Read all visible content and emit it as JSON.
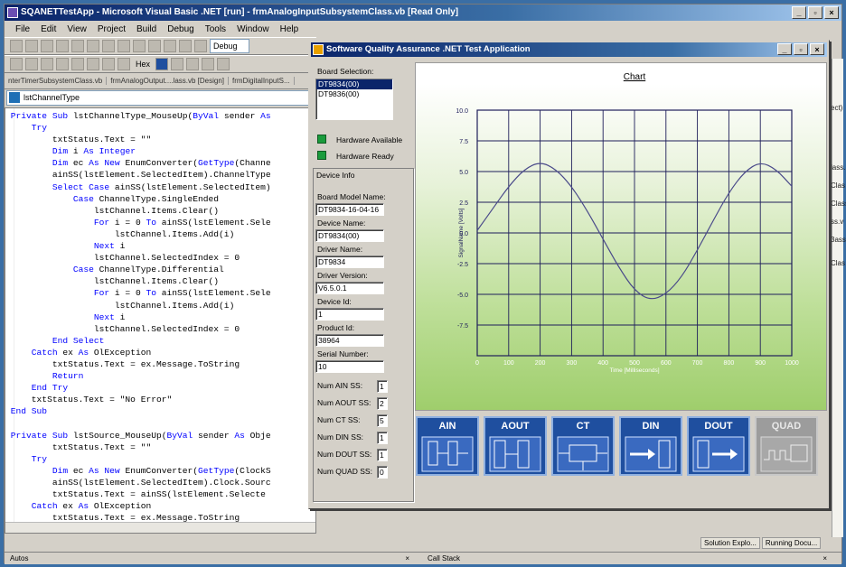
{
  "ide": {
    "title": "SQANETTestApp - Microsoft Visual Basic .NET [run] - frmAnalogInputSubsystemClass.vb [Read Only]",
    "menu": [
      "File",
      "Edit",
      "View",
      "Project",
      "Build",
      "Debug",
      "Tools",
      "Window",
      "Help"
    ],
    "debug_combo": "Debug",
    "hex_label": "Hex",
    "doc_tabs": [
      "nterTimerSubsystemClass.vb",
      "frmAnalogOutput....lass.vb [Design]",
      "frmDigitalInputS..."
    ],
    "member_combo": "lstChannelType",
    "right_texts": [
      "ect)",
      "lass.",
      "Clas",
      "Class",
      "ss.v",
      "3ass",
      "Clas"
    ],
    "bottom_tabs": [
      "Solution Explo...",
      "Running Docu..."
    ],
    "bottom_panes": [
      "Autos",
      "Call Stack"
    ],
    "colors": {
      "title_bar": "#0a246a",
      "keyword": "#0000ff",
      "led": "#1a9b3c",
      "button_blue": "#1f4f9f"
    }
  },
  "code": [
    {
      "indent": 0,
      "parts": [
        [
          "kw",
          "Private Sub "
        ],
        [
          "",
          "lstChannelType_MouseUp("
        ],
        [
          "kw",
          "ByVal"
        ],
        [
          "",
          " sender "
        ],
        [
          "kw",
          "As"
        ]
      ]
    },
    {
      "indent": 1,
      "parts": [
        [
          "kw",
          "Try"
        ]
      ]
    },
    {
      "indent": 2,
      "parts": [
        [
          "",
          "txtStatus.Text = \"\""
        ]
      ]
    },
    {
      "indent": 2,
      "parts": [
        [
          "kw",
          "Dim"
        ],
        [
          "",
          " i "
        ],
        [
          "kw",
          "As Integer"
        ]
      ]
    },
    {
      "indent": 2,
      "parts": [
        [
          "kw",
          "Dim"
        ],
        [
          "",
          " ec "
        ],
        [
          "kw",
          "As New"
        ],
        [
          "",
          " EnumConverter("
        ],
        [
          "kw",
          "GetType"
        ],
        [
          "",
          "(Channe"
        ]
      ]
    },
    {
      "indent": 2,
      "parts": [
        [
          "",
          "ainSS(lstElement.SelectedItem).ChannelType"
        ]
      ]
    },
    {
      "indent": 2,
      "parts": [
        [
          "kw",
          "Select Case"
        ],
        [
          "",
          " ainSS(lstElement.SelectedItem)"
        ]
      ]
    },
    {
      "indent": 3,
      "parts": [
        [
          "kw",
          "Case"
        ],
        [
          "",
          " ChannelType.SingleEnded"
        ]
      ]
    },
    {
      "indent": 4,
      "parts": [
        [
          "",
          "lstChannel.Items.Clear()"
        ]
      ]
    },
    {
      "indent": 4,
      "parts": [
        [
          "kw",
          "For"
        ],
        [
          "",
          " i = 0 "
        ],
        [
          "kw",
          "To"
        ],
        [
          "",
          " ainSS(lstElement.Sele"
        ]
      ]
    },
    {
      "indent": 5,
      "parts": [
        [
          "",
          "lstChannel.Items.Add(i)"
        ]
      ]
    },
    {
      "indent": 4,
      "parts": [
        [
          "kw",
          "Next"
        ],
        [
          "",
          " i"
        ]
      ]
    },
    {
      "indent": 4,
      "parts": [
        [
          "",
          "lstChannel.SelectedIndex = 0"
        ]
      ]
    },
    {
      "indent": 3,
      "parts": [
        [
          "kw",
          "Case"
        ],
        [
          "",
          " ChannelType.Differential"
        ]
      ]
    },
    {
      "indent": 4,
      "parts": [
        [
          "",
          "lstChannel.Items.Clear()"
        ]
      ]
    },
    {
      "indent": 4,
      "parts": [
        [
          "kw",
          "For"
        ],
        [
          "",
          " i = 0 "
        ],
        [
          "kw",
          "To"
        ],
        [
          "",
          " ainSS(lstElement.Sele"
        ]
      ]
    },
    {
      "indent": 5,
      "parts": [
        [
          "",
          "lstChannel.Items.Add(i)"
        ]
      ]
    },
    {
      "indent": 4,
      "parts": [
        [
          "kw",
          "Next"
        ],
        [
          "",
          " i"
        ]
      ]
    },
    {
      "indent": 4,
      "parts": [
        [
          "",
          "lstChannel.SelectedIndex = 0"
        ]
      ]
    },
    {
      "indent": 2,
      "parts": [
        [
          "kw",
          "End Select"
        ]
      ]
    },
    {
      "indent": 1,
      "parts": [
        [
          "kw",
          "Catch"
        ],
        [
          "",
          " ex "
        ],
        [
          "kw",
          "As"
        ],
        [
          "",
          " OlException"
        ]
      ]
    },
    {
      "indent": 2,
      "parts": [
        [
          "",
          "txtStatus.Text = ex.Message.ToString"
        ]
      ]
    },
    {
      "indent": 2,
      "parts": [
        [
          "kw",
          "Return"
        ]
      ]
    },
    {
      "indent": 1,
      "parts": [
        [
          "kw",
          "End Try"
        ]
      ]
    },
    {
      "indent": 1,
      "parts": [
        [
          "",
          "txtStatus.Text = \"No Error\""
        ]
      ]
    },
    {
      "indent": 0,
      "parts": [
        [
          "kw",
          "End Sub"
        ]
      ]
    },
    {
      "indent": 0,
      "parts": [
        [
          "",
          ""
        ]
      ]
    },
    {
      "indent": 0,
      "parts": [
        [
          "kw",
          "Private Sub "
        ],
        [
          "",
          "lstSource_MouseUp("
        ],
        [
          "kw",
          "ByVal"
        ],
        [
          "",
          " sender "
        ],
        [
          "kw",
          "As"
        ],
        [
          "",
          " Obje"
        ]
      ]
    },
    {
      "indent": 2,
      "parts": [
        [
          "",
          "txtStatus.Text = \"\""
        ]
      ]
    },
    {
      "indent": 1,
      "parts": [
        [
          "kw",
          "Try"
        ]
      ]
    },
    {
      "indent": 2,
      "parts": [
        [
          "kw",
          "Dim"
        ],
        [
          "",
          " ec "
        ],
        [
          "kw",
          "As New"
        ],
        [
          "",
          " EnumConverter("
        ],
        [
          "kw",
          "GetType"
        ],
        [
          "",
          "(ClockS"
        ]
      ]
    },
    {
      "indent": 2,
      "parts": [
        [
          "",
          "ainSS(lstElement.SelectedItem).Clock.Sourc"
        ]
      ]
    },
    {
      "indent": 2,
      "parts": [
        [
          "",
          "txtStatus.Text = ainSS(lstElement.Selecte"
        ]
      ]
    },
    {
      "indent": 1,
      "parts": [
        [
          "kw",
          "Catch"
        ],
        [
          "",
          " ex "
        ],
        [
          "kw",
          "As"
        ],
        [
          "",
          " OlException"
        ]
      ]
    },
    {
      "indent": 2,
      "parts": [
        [
          "",
          "txtStatus.Text = ex.Message.ToString"
        ]
      ]
    },
    {
      "indent": 2,
      "parts": [
        [
          "kw",
          "Return"
        ]
      ]
    },
    {
      "indent": 1,
      "parts": [
        [
          "kw",
          "End Try"
        ]
      ]
    },
    {
      "indent": 1,
      "parts": [
        [
          "",
          "txtStatus.Text = \"No Error\""
        ]
      ]
    }
  ],
  "testapp": {
    "title": "Software Quality Assurance .NET Test Application",
    "board_selection_label": "Board Selection:",
    "boards": [
      "DT9834(00)",
      "DT9836(00)"
    ],
    "selected_board_index": 0,
    "hardware_available": "Hardware Available",
    "hardware_ready": "Hardware Ready",
    "device_info_label": "Device Info",
    "fields": [
      {
        "label": "Board Model Name:",
        "value": "DT9834-16-04-16"
      },
      {
        "label": "Device Name:",
        "value": "DT9834(00)"
      },
      {
        "label": "Driver Name:",
        "value": "DT9834"
      },
      {
        "label": "Driver Version:",
        "value": "V6.5.0.1"
      },
      {
        "label": "Device Id:",
        "value": "1"
      },
      {
        "label": "Product Id:",
        "value": "38964"
      },
      {
        "label": "Serial Number:",
        "value": "10"
      }
    ],
    "counts": [
      {
        "label": "Num AIN SS:",
        "value": "1"
      },
      {
        "label": "Num AOUT SS:",
        "value": "2"
      },
      {
        "label": "Num CT SS:",
        "value": "5"
      },
      {
        "label": "Num DIN SS:",
        "value": "1"
      },
      {
        "label": "Num DOUT SS:",
        "value": "1"
      },
      {
        "label": "Num QUAD SS:",
        "value": "0"
      }
    ],
    "subsystems": [
      {
        "label": "AIN",
        "enabled": true
      },
      {
        "label": "AOUT",
        "enabled": true
      },
      {
        "label": "CT",
        "enabled": true
      },
      {
        "label": "DIN",
        "enabled": true
      },
      {
        "label": "DOUT",
        "enabled": true
      },
      {
        "label": "QUAD",
        "enabled": false
      }
    ]
  },
  "chart_data": {
    "type": "line",
    "title": "Chart",
    "xlabel": "Time [Milliseconds]",
    "ylabel": "SignalName [Volts]",
    "xlim": [
      0,
      1000
    ],
    "ylim": [
      -10,
      10
    ],
    "x_ticks": [
      0,
      100,
      200,
      300,
      400,
      500,
      600,
      700,
      800,
      900,
      1000
    ],
    "y_ticks": [
      "10.0",
      "7.5",
      "5.0",
      "2.5",
      "0.0",
      "-2.5",
      "-5.0",
      "-7.5"
    ],
    "grid": true,
    "series": [
      {
        "x": [
          0,
          50,
          100,
          150,
          200,
          250,
          300,
          350,
          400,
          450,
          500,
          550,
          600,
          650,
          700,
          750,
          800,
          850,
          900,
          950,
          1000
        ],
        "values": [
          0.2,
          2.0,
          3.8,
          5.2,
          5.8,
          5.2,
          3.8,
          1.8,
          -0.5,
          -2.8,
          -4.7,
          -5.5,
          -5.0,
          -3.6,
          -1.4,
          1.0,
          3.3,
          5.0,
          5.8,
          5.2,
          3.8
        ]
      }
    ],
    "line_color": "#4a4a8a"
  }
}
